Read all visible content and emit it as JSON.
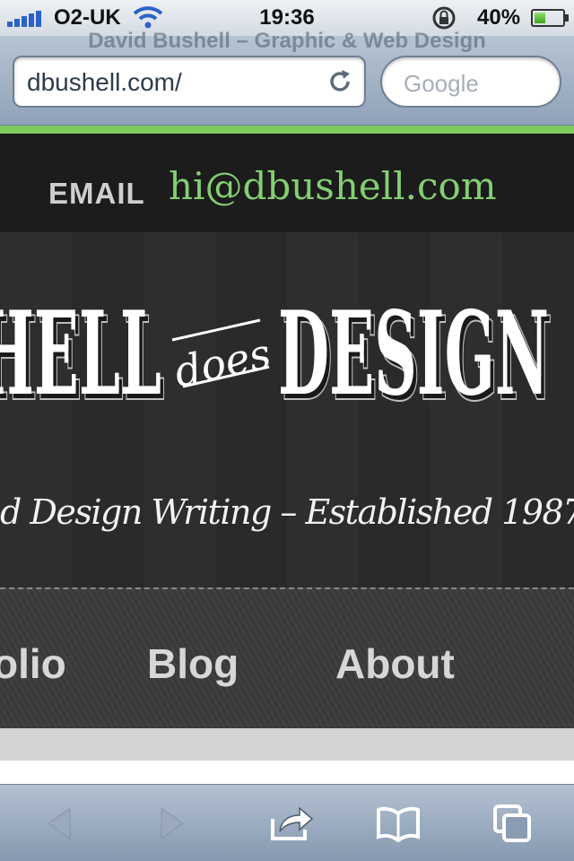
{
  "status_bar": {
    "carrier": "O2-UK",
    "time": "19:36",
    "battery_percent": "40%",
    "battery_level": 0.4
  },
  "browser": {
    "page_title": "David Bushell – Graphic & Web Design",
    "url": "dbushell.com/",
    "search_placeholder": "Google"
  },
  "site": {
    "accent_color": "#7ccc5f",
    "email_label": "EMAIL",
    "email_address": "hi@dbushell.com",
    "logo_left": "HELL",
    "logo_middle": "does",
    "logo_right": "DESIGN",
    "tagline": "d Design Writing – Established 1987",
    "nav": [
      {
        "label": "olio"
      },
      {
        "label": "Blog"
      },
      {
        "label": "About"
      }
    ]
  },
  "toolbar": {
    "icons": [
      "back-icon",
      "forward-icon",
      "share-icon",
      "bookmarks-icon",
      "tabs-icon"
    ]
  }
}
